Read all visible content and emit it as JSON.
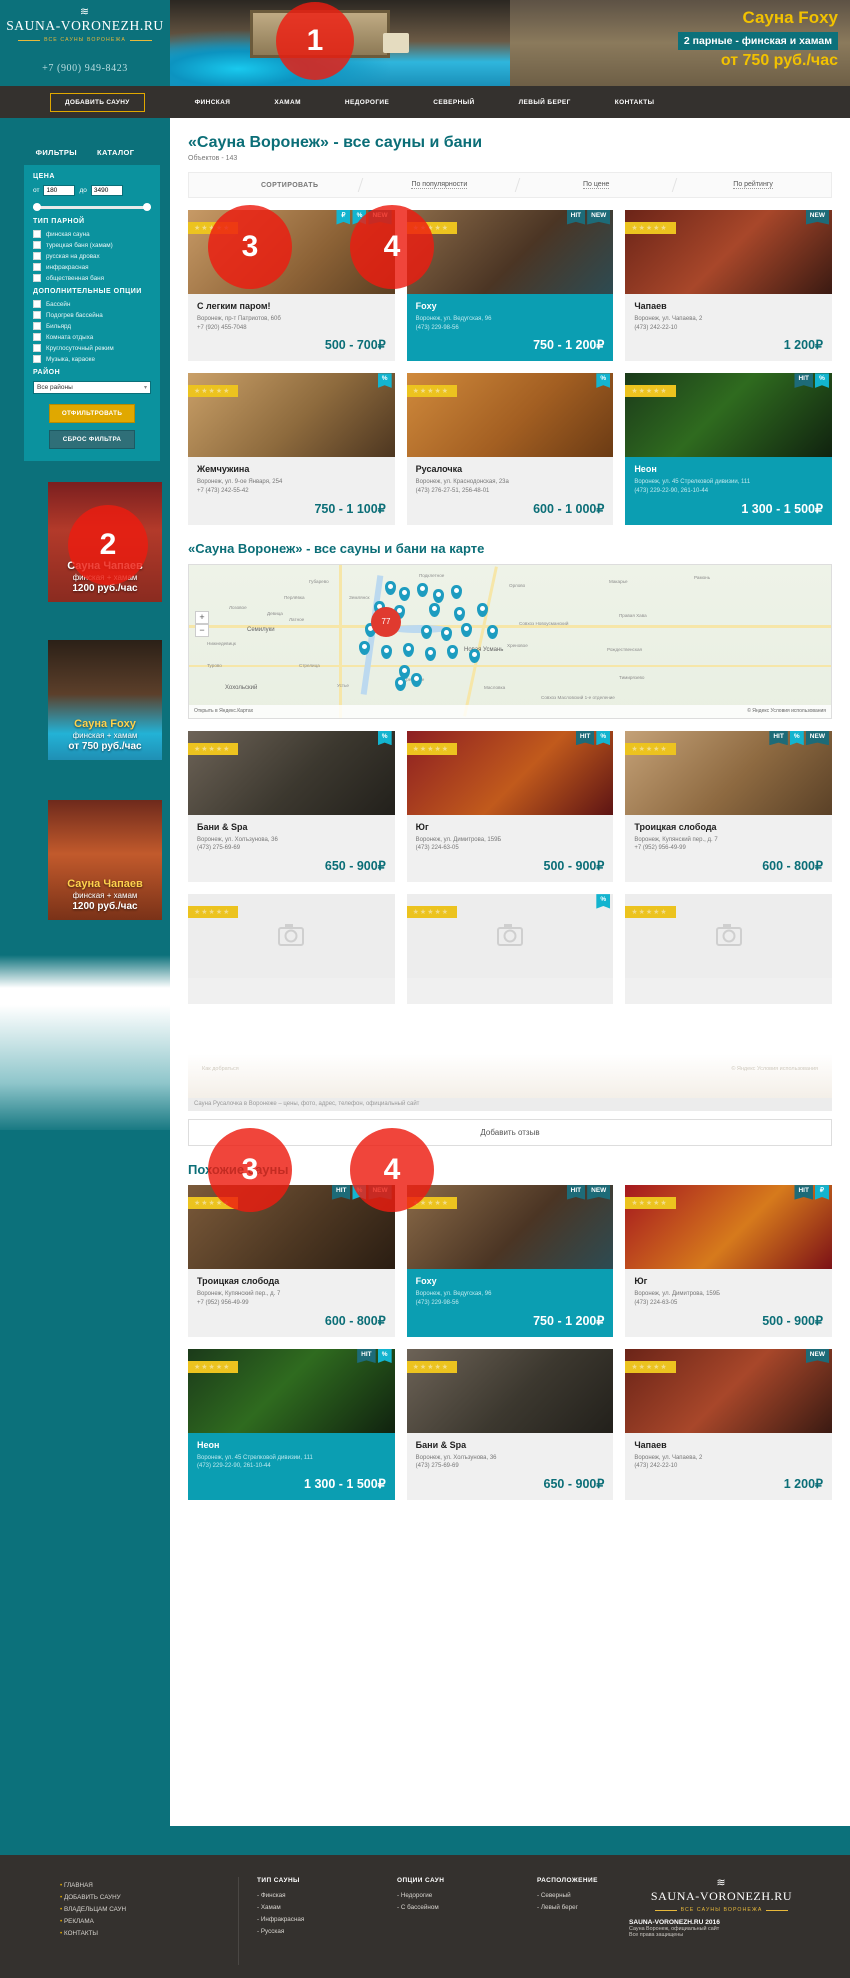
{
  "site": {
    "logo_title": "SAUNA-VORONEZH.RU",
    "logo_sub": "ВСЕ САУНЫ ВОРОНЕЖА",
    "phone": "+7 (900) 949-8423"
  },
  "hero_banner": {
    "title": "Сауна Foxy",
    "subtitle": "2 парные - финская и хамам",
    "price": "от 750 руб./час"
  },
  "nav": {
    "add_button": "ДОБАВИТЬ САУНУ",
    "items": [
      {
        "label": "ФИНСКАЯ"
      },
      {
        "label": "ХАМАМ"
      },
      {
        "label": "НЕДОРОГИЕ"
      },
      {
        "label": "СЕВЕРНЫЙ"
      },
      {
        "label": "ЛЕВЫЙ БЕРЕГ"
      },
      {
        "label": "КОНТАКТЫ"
      }
    ]
  },
  "sidebar": {
    "tabs": [
      {
        "label": "ФИЛЬТРЫ"
      },
      {
        "label": "КАТАЛОГ"
      }
    ],
    "price": {
      "heading": "ЦЕНА",
      "from_label": "от",
      "from_value": "180",
      "to_label": "до",
      "to_value": "3490"
    },
    "steam_type": {
      "heading": "ТИП ПАРНОЙ",
      "options": [
        {
          "label": "финская сауна"
        },
        {
          "label": "турецкая баня (хамам)"
        },
        {
          "label": "русская на дровах"
        },
        {
          "label": "инфракрасная"
        },
        {
          "label": "общественная баня"
        }
      ]
    },
    "extra_options": {
      "heading": "ДОПОЛНИТЕЛЬНЫЕ ОПЦИИ",
      "options": [
        {
          "label": "Бассейн"
        },
        {
          "label": "Подогрев бассейна"
        },
        {
          "label": "Бильярд"
        },
        {
          "label": "Комната отдыха"
        },
        {
          "label": "Круглосуточный режим"
        },
        {
          "label": "Музыка, караоке"
        }
      ]
    },
    "district": {
      "heading": "РАЙОН",
      "selected": "Все районы"
    },
    "apply_button": "ОТФИЛЬТРОВАТЬ",
    "reset_button": "СБРОС ФИЛЬТРА",
    "promos": [
      {
        "line1": "Сауна  Чапаев",
        "line2": "финская + хамам",
        "line3": "1200  руб./час"
      },
      {
        "line1": "Сауна Foxy",
        "line2": "финская + хамам",
        "line3": "от 750 руб./час"
      },
      {
        "line1": "Сауна Чапаев",
        "line2": "финская + хамам",
        "line3": "1200  руб./час"
      }
    ]
  },
  "main": {
    "title": "«Сауна Воронеж» - все сауны и бани",
    "count": "Объектов - 143",
    "sort": {
      "label": "СОРТИРОВАТЬ",
      "options": [
        {
          "label": "По популярности"
        },
        {
          "label": "По цене"
        },
        {
          "label": "По рейтингу"
        }
      ]
    },
    "map_section_title": "«Сауна Воронеж» - все сауны и бани на карте",
    "map": {
      "open_link": "Открыть в Яндекс.Картах",
      "attribution": "© Яндекс  Условия использования",
      "cluster_count": "77",
      "zoom_in": "+",
      "zoom_out": "−",
      "labels": [
        "Губарево",
        "Подклетное",
        "Орлово",
        "Макарье",
        "Рамонь",
        "Лозовое",
        "Семилуки",
        "Правая Хава",
        "Совхоз Новоусманский",
        "Новая Усмань",
        "Хреновое",
        "Рождественская",
        "Тимирязево",
        "Гремячье",
        "Масловка",
        "Хохольский",
        "Устье",
        "Совхоз Масловский 1-е отделение",
        "Стрелица",
        "Латное",
        "Нижнедевицк",
        "Перлёвка",
        "Девица",
        "Землянск",
        "Турово"
      ]
    },
    "review_note": "Сауна Русалочка в Воронеже – цены, фото, адрес, телефон, официальный сайт",
    "add_review_button": "Добавить отзыв",
    "similar_title": "Похожие сауны",
    "faint_note_left": "Как добраться",
    "faint_note_right": "© Яндекс  Условия использования",
    "no_photo_text": "НЕТ ФОТО"
  },
  "cards_row1": [
    {
      "title": "С легким паром!",
      "title_highlight": "паром!",
      "address": "Воронеж, пр-т Патриотов, 60б",
      "phone": "+7 (920) 455-7048",
      "price": "500 - 700₽",
      "badges": [
        "₽",
        "%",
        "NEW"
      ],
      "stars": "★★★★★",
      "featured": false
    },
    {
      "title": "Foxy",
      "address": "Воронеж, ул. Ведугская, 96",
      "phone": "(473) 229-98-56",
      "price": "750 - 1 200₽",
      "badges": [
        "HIT",
        "NEW"
      ],
      "stars": "★★★★★",
      "featured": true
    },
    {
      "title": "Чапаев",
      "address": "Воронеж, ул. Чапаева, 2",
      "phone": "(473) 242-22-10",
      "price": "1 200₽",
      "badges": [
        "NEW"
      ],
      "stars": "★★★★★",
      "featured": false
    }
  ],
  "cards_row2": [
    {
      "title": "Жемчужина",
      "address": "Воронеж, ул. 9-ое Января, 254",
      "phone": "+7 (473) 242-55-42",
      "price": "750 - 1 100₽",
      "badges": [
        "%"
      ],
      "stars": "★★★★★",
      "featured": false
    },
    {
      "title": "Русалочка",
      "address": "Воронеж, ул. Краснодонская, 23а",
      "phone": "(473) 276-27-51, 256-48-01",
      "price": "600 - 1 000₽",
      "badges": [
        "%"
      ],
      "stars": "★★★★★",
      "featured": false
    },
    {
      "title": "Неон",
      "address": "Воронеж, ул. 45 Стрелковой дивизии, 111",
      "phone": "(473) 229-22-90, 261-10-44",
      "price": "1 300 - 1 500₽",
      "badges": [
        "HIT",
        "%"
      ],
      "stars": "★★★★★",
      "featured": true
    }
  ],
  "cards_row3": [
    {
      "title": "Бани & Spa",
      "address": "Воронеж, ул. Холъзунова, 36",
      "phone": "(473) 275-69-69",
      "price": "650 - 900₽",
      "badges": [
        "%"
      ],
      "stars": "★★★★★",
      "featured": false
    },
    {
      "title": "Юг",
      "address": "Воронеж, ул. Димитрова, 159Б",
      "phone": "(473) 224-63-05",
      "price": "500 - 900₽",
      "badges": [
        "HIT",
        "%"
      ],
      "stars": "★★★★★",
      "featured": false
    },
    {
      "title": "Троицкая слобода",
      "address": "Воронеж, Купянский пер., д. 7",
      "phone": "+7 (952) 956-49-99",
      "price": "600 - 800₽",
      "badges": [
        "HIT",
        "%",
        "NEW"
      ],
      "stars": "★★★★★",
      "featured": false
    }
  ],
  "cards_row4": [
    {
      "title": "",
      "address": "",
      "phone": "",
      "price": "",
      "badges": [],
      "stars": "★★★★★",
      "no_photo": true
    },
    {
      "title": "",
      "address": "",
      "phone": "",
      "price": "",
      "badges": [
        "%"
      ],
      "stars": "★★★★★",
      "no_photo": true
    },
    {
      "title": "",
      "address": "",
      "phone": "",
      "price": "",
      "badges": [],
      "stars": "★★★★★",
      "no_photo": true
    }
  ],
  "similar_row1": [
    {
      "title": "Троицкая слобода",
      "title_highlight": "слобода",
      "address": "Воронеж, Купянский пер., д. 7",
      "phone": "+7 (952) 956-49-99",
      "price": "600 - 800₽",
      "badges": [
        "HIT",
        "%",
        "NEW"
      ],
      "stars": "★★★★★",
      "featured": false
    },
    {
      "title": "Foxy",
      "address": "Воронеж, ул. Ведугская, 96",
      "phone": "(473) 229-98-56",
      "price": "750 - 1 200₽",
      "badges": [
        "HIT",
        "NEW"
      ],
      "stars": "★★★★★",
      "featured": true
    },
    {
      "title": "Юг",
      "address": "Воронеж, ул. Димитрова, 159Б",
      "phone": "(473) 224-63-05",
      "price": "500 - 900₽",
      "badges": [
        "HIT",
        "₽"
      ],
      "stars": "★★★★★",
      "featured": false
    }
  ],
  "similar_row2": [
    {
      "title": "Неон",
      "address": "Воронеж, ул. 45 Стрелковой дивизии, 111",
      "phone": "(473) 229-22-90, 261-10-44",
      "price": "1 300 - 1 500₽",
      "badges": [
        "HIT",
        "%"
      ],
      "stars": "★★★★★",
      "featured": true
    },
    {
      "title": "Бани & Spa",
      "address": "Воронеж, ул. Холъзунова, 36",
      "phone": "(473) 275-69-69",
      "price": "650 - 900₽",
      "badges": [],
      "stars": "★★★★★",
      "featured": false
    },
    {
      "title": "Чапаев",
      "address": "Воронеж, ул. Чапаева, 2",
      "phone": "(473) 242-22-10",
      "price": "1 200₽",
      "badges": [
        "NEW"
      ],
      "stars": "★★★★★",
      "featured": false
    }
  ],
  "footer": {
    "col1": [
      {
        "label": "ГЛАВНАЯ"
      },
      {
        "label": "ДОБАВИТЬ САУНУ"
      },
      {
        "label": "ВЛАДЕЛЬЦАМ САУН"
      },
      {
        "label": "РЕКЛАМА"
      },
      {
        "label": "КОНТАКТЫ"
      }
    ],
    "col2": {
      "heading": "ТИП САУНЫ",
      "items": [
        {
          "label": "- Финская"
        },
        {
          "label": "- Хамам"
        },
        {
          "label": "- Инфракрасная"
        },
        {
          "label": "- Русская"
        }
      ]
    },
    "col3": {
      "heading": "ОПЦИИ САУН",
      "items": [
        {
          "label": "- Недорогие"
        },
        {
          "label": "- С бассейном"
        }
      ]
    },
    "col4": {
      "heading": "РАСПОЛОЖЕНИЕ",
      "items": [
        {
          "label": "- Северный"
        },
        {
          "label": "- Левый берег"
        }
      ]
    },
    "brand": "SAUNA-VORONEZH.RU",
    "brand_sub": "ВСЕ САУНЫ ВОРОНЕЖА",
    "copyright_line1": "SAUNA-VORONEZH.RU 2016",
    "copyright_line2": "Сауна Воронеж, официальный сайт",
    "copyright_line3": "Все права защищены"
  },
  "overlays": [
    {
      "label": "1"
    },
    {
      "label": "2"
    },
    {
      "label": "3"
    },
    {
      "label": "4"
    },
    {
      "label": "3"
    },
    {
      "label": "4"
    },
    {
      "label": "3"
    },
    {
      "label": "4"
    }
  ],
  "colors": {
    "teal": "#0c717b",
    "teal_light": "#0b9eb2",
    "accent_yellow": "#e0a800",
    "badge_blue": "#13b4cf",
    "badge_dark": "#1d6b78",
    "overlay_red": "#ed1c10"
  }
}
